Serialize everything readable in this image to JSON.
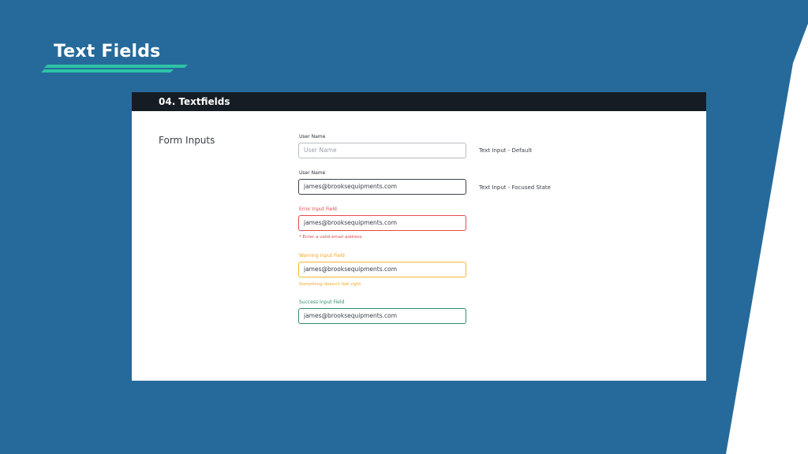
{
  "slide": {
    "title": "Text Fields",
    "colors": {
      "background": "#266a9b",
      "accent": "#2ec4a6",
      "header_bar": "#161c24"
    }
  },
  "card": {
    "header_title": "04. Textfields",
    "section_title": "Form Inputs",
    "fields": [
      {
        "label": "User Name",
        "value": "",
        "placeholder": "User Name",
        "state": "default",
        "note": "Text Input - Default"
      },
      {
        "label": "User Name",
        "value": "james@brooksequipments.com",
        "state": "focused",
        "note": "Text Input - Focused State"
      },
      {
        "label": "Error Input Field",
        "value": "james@brooksequipments.com",
        "state": "error",
        "helper": "* Enter a valid email address",
        "color": "#e5484d"
      },
      {
        "label": "Warning Input Field",
        "value": "james@brooksequipments.com",
        "state": "warning",
        "helper": "Something doesn't feel right",
        "color": "#f5a623"
      },
      {
        "label": "Success Input Field",
        "value": "james@brooksequipments.com",
        "state": "success",
        "color": "#2f8f6a"
      }
    ]
  }
}
